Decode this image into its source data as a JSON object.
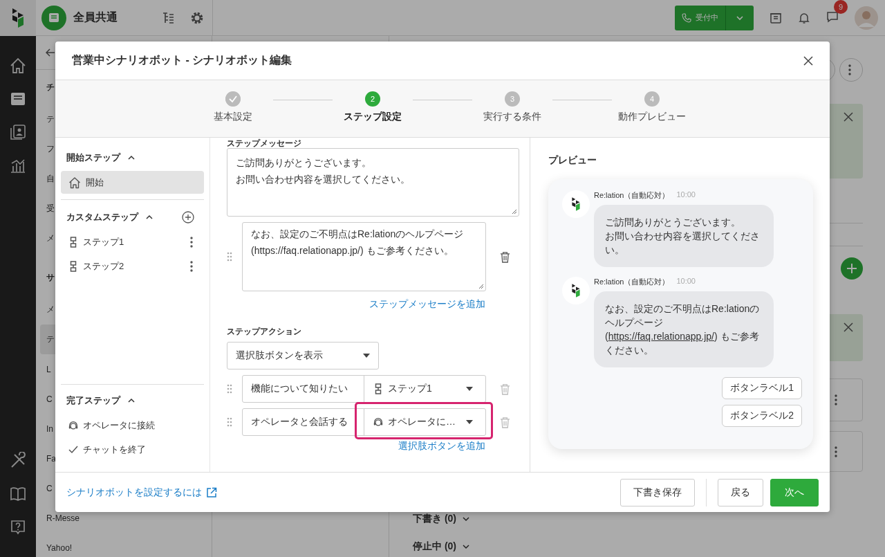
{
  "top_bar": {
    "workspace": "全員共通",
    "status_button": "受付中",
    "notification_count": "9"
  },
  "background": {
    "sidebar_items": [
      {
        "label": "チ",
        "kind": "heading",
        "selected": false
      },
      {
        "label": "テ",
        "kind": "item",
        "selected": false
      },
      {
        "label": "フ",
        "kind": "item",
        "selected": false
      },
      {
        "label": "自",
        "kind": "item",
        "selected": false
      },
      {
        "label": "受",
        "kind": "item",
        "selected": false
      },
      {
        "label": "メ",
        "kind": "item",
        "selected": false
      },
      {
        "label": "サ",
        "kind": "heading",
        "selected": false
      },
      {
        "label": "メ",
        "kind": "item",
        "selected": false
      },
      {
        "label": "テ",
        "kind": "item",
        "selected": true
      },
      {
        "label": "L",
        "kind": "item",
        "selected": false
      },
      {
        "label": "C",
        "kind": "item",
        "selected": false
      },
      {
        "label": "In",
        "kind": "item",
        "selected": false
      },
      {
        "label": "Fa",
        "kind": "item",
        "selected": false
      },
      {
        "label": "C",
        "kind": "item",
        "selected": false
      },
      {
        "label": "R-Messe",
        "kind": "item",
        "selected": false
      },
      {
        "label": "Yahoo!",
        "kind": "item",
        "selected": false
      }
    ],
    "sections": [
      {
        "label": "下書き (0)",
        "expanded": false
      },
      {
        "label": "停止中 (0)",
        "expanded": false
      }
    ]
  },
  "dialog": {
    "title": "営業中シナリオボット - シナリオボット編集",
    "steps": [
      {
        "label": "基本設定",
        "done": true,
        "selected": false
      },
      {
        "number": "2",
        "label": "ステップ設定",
        "done": false,
        "selected": true
      },
      {
        "number": "3",
        "label": "実行する条件",
        "done": false,
        "selected": false
      },
      {
        "number": "4",
        "label": "動作プレビュー",
        "done": false,
        "selected": false
      }
    ],
    "step_list": [
      {
        "title": "開始ステップ",
        "expanded": true,
        "addable": false,
        "items": [
          {
            "label": "開始",
            "kind": "home",
            "selected": true,
            "menu": false
          }
        ]
      },
      {
        "title": "カスタムステップ",
        "expanded": true,
        "addable": true,
        "items": [
          {
            "label": "ステップ1",
            "kind": "step",
            "selected": false,
            "menu": true
          },
          {
            "label": "ステップ2",
            "kind": "step",
            "selected": false,
            "menu": true
          }
        ]
      },
      {
        "title": "完了ステップ",
        "expanded": true,
        "addable": false,
        "items": [
          {
            "label": "オペレータに接続",
            "kind": "operator",
            "selected": false,
            "menu": false
          },
          {
            "label": "チャットを終了",
            "kind": "check",
            "selected": false,
            "menu": false
          }
        ]
      }
    ],
    "editor": {
      "message_label": "ステップメッセージ",
      "messages": [
        {
          "lines": [
            "ご訪問ありがとうございます。",
            "お問い合わせ内容を選択してください。"
          ],
          "removable": false
        },
        {
          "lines": [
            "なお、設定のご不明点はRe:lationのヘルプページ (https://faq.relationapp.jp/) もご参考ください。"
          ],
          "removable": true
        }
      ],
      "add_message": "ステップメッセージを追加",
      "action_label": "ステップアクション",
      "action_type": "選択肢ボタンを表示",
      "choices": [
        {
          "label": "機能について知りたい",
          "target": "ステップ1",
          "kind": "step",
          "highlighted": false
        },
        {
          "label": "オペレータと会話する",
          "target": "オペレータに…",
          "kind": "operator",
          "highlighted": true
        }
      ],
      "add_choice": "選択肢ボタンを追加"
    },
    "preview": {
      "title": "プレビュー",
      "messages": [
        {
          "sender": "Re:lation（自動応対）",
          "time": "10:00",
          "lines": [
            "ご訪問ありがとうございます。",
            "お問い合わせ内容を選択してください。"
          ]
        },
        {
          "sender": "Re:lation（自動応対）",
          "time": "10:00",
          "parts": [
            {
              "kind": "text",
              "text": "なお、設定のご不明点はRe:lationのヘルプページ ("
            },
            {
              "kind": "link",
              "text": "https://faq.relationapp.jp/"
            },
            {
              "kind": "text",
              "text": ") もご参考ください。"
            }
          ]
        }
      ],
      "choices": [
        "ボタンラベル1",
        "ボタンラベル2"
      ]
    },
    "footer": {
      "help_link": "シナリオボットを設定するには",
      "buttons": [
        {
          "label": "下書き保存",
          "kind": "secondary"
        },
        {
          "label": "戻る",
          "kind": "secondary"
        },
        {
          "label": "次へ",
          "kind": "primary"
        }
      ]
    }
  }
}
